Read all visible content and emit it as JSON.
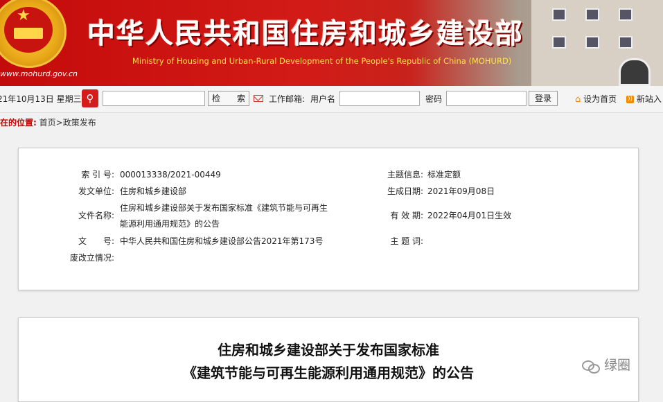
{
  "header": {
    "site_url": "www.mohurd.gov.cn",
    "title_cn": "中华人民共和国住房和城乡建设部",
    "title_en": "Ministry of Housing and Urban-Rural Development of the People's Republic of China (MOHURD)"
  },
  "toolbar": {
    "date": "21年10月13日 星期三",
    "search_button": "检　　索",
    "mail_label": "工作邮箱:",
    "username_label": "用户名",
    "password_label": "密码",
    "login_button": "登录",
    "set_home": "设为首页",
    "new_site": "新站入"
  },
  "breadcrumb": {
    "label": "在的位置:",
    "path": "首页>政策发布"
  },
  "meta": {
    "index_key": "索 引 号:",
    "index_val": "000013338/2021-00449",
    "theme_key": "主题信息:",
    "theme_val": "标准定额",
    "issuer_key": "发文单位:",
    "issuer_val": "住房和城乡建设部",
    "date_key": "生成日期:",
    "date_val": "2021年09月08日",
    "docname_key": "文件名称:",
    "docname_val1": "住房和城乡建设部关于发布国家标准《建筑节能与可再生",
    "docname_val2": "能源利用通用规范》的公告",
    "valid_key": "有 效 期:",
    "valid_val": "2022年04月01日生效",
    "docno_key": "文　　号:",
    "docno_val": "中华人民共和国住房和城乡建设部公告2021年第173号",
    "keyword_key": "主 题 词:",
    "keyword_val": "",
    "status_key": "废改立情况:",
    "status_val": ""
  },
  "article": {
    "title_line1": "住房和城乡建设部关于发布国家标准",
    "title_line2": "《建筑节能与可再生能源利用通用规范》的公告"
  },
  "watermark": {
    "text": "绿圈"
  }
}
